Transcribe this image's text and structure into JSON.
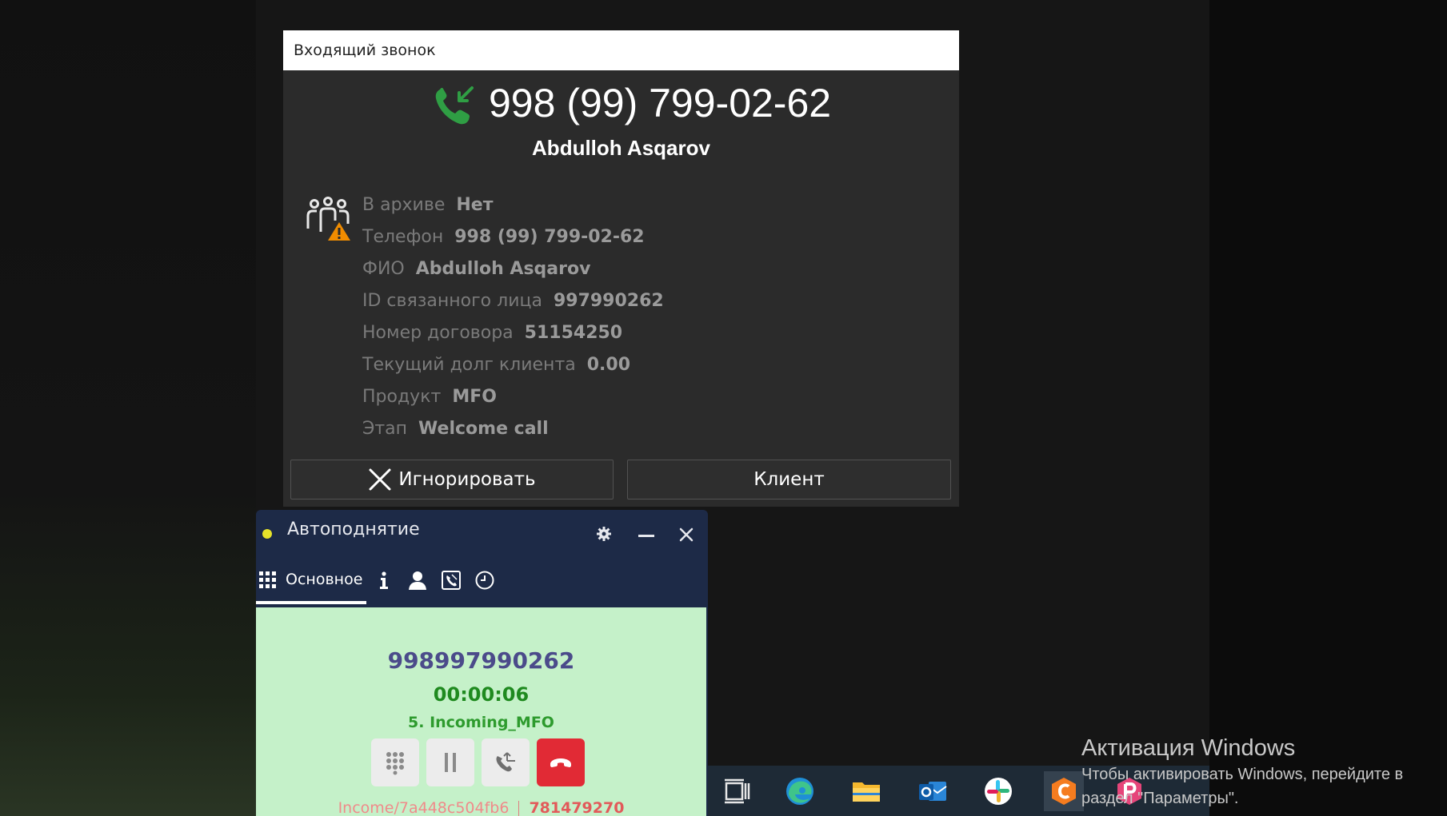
{
  "incoming_call": {
    "title": "Входящий звонок",
    "phone_number": "998 (99) 799-02-62",
    "caller_name": "Abdulloh Asqarov",
    "details": [
      {
        "label": "В архиве",
        "value": "Нет"
      },
      {
        "label": "Телефон",
        "value": "998 (99) 799-02-62"
      },
      {
        "label": "ФИО",
        "value": "Abdulloh Asqarov"
      },
      {
        "label": "ID связанного лица",
        "value": "997990262"
      },
      {
        "label": "Номер договора",
        "value": "51154250"
      },
      {
        "label": "Текущий долг клиента",
        "value": "0.00"
      },
      {
        "label": "Продукт",
        "value": "MFO"
      },
      {
        "label": "Этап",
        "value": "Welcome call"
      }
    ],
    "ignore_label": "Игнорировать",
    "client_label": "Клиент",
    "icons": {
      "phone": "incoming-call-icon",
      "people": "contacts-warning-icon",
      "ignore": "close-icon"
    },
    "colors": {
      "phone_icon": "#2f9e44",
      "warning": "#f08c00"
    }
  },
  "softphone": {
    "title": "Автоподнятие",
    "status_color": "#e6e22a",
    "tabs": [
      {
        "label": "Основное",
        "icon": "dialpad-grid-icon",
        "active": true
      },
      {
        "label": "",
        "icon": "info-icon"
      },
      {
        "label": "",
        "icon": "user-icon"
      },
      {
        "label": "",
        "icon": "phone-book-icon"
      },
      {
        "label": "",
        "icon": "history-clock-icon"
      }
    ],
    "call": {
      "number": "998997990262",
      "timer": "00:00:06",
      "queue": "5. Incoming_MFO"
    },
    "controls": [
      "dialpad-icon",
      "pause-icon",
      "transfer-icon",
      "hangup-icon"
    ],
    "footer": {
      "call_id": "Income/7a448c504fb6",
      "contract": "781479270"
    },
    "colors": {
      "header": "#1d2a47",
      "body": "#c5f1c9",
      "hangup": "#e12a35"
    }
  },
  "taskbar": {
    "items": [
      "task-view-icon",
      "edge-icon",
      "file-explorer-icon",
      "outlook-icon",
      "slack-icon",
      "orange-app-icon",
      "pink-app-icon"
    ]
  },
  "activation": {
    "title": "Активация Windows",
    "line1": "Чтобы активировать Windows, перейдите в",
    "line2": "раздел \"Параметры\"."
  }
}
